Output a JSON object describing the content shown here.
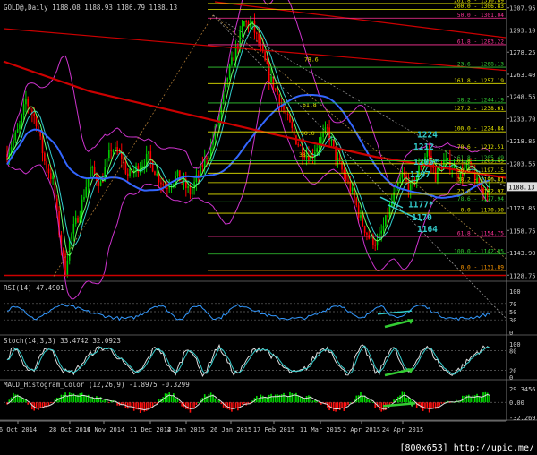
{
  "panels": {
    "price": {
      "label": "GOLD@,Daily  1188.08 1188.93 1186.79 1188.13",
      "ylim": [
        1125.3,
        1312.0
      ],
      "ticks": [
        "1307.95",
        "1293.10",
        "1278.25",
        "1263.40",
        "1248.55",
        "1233.70",
        "1218.85",
        "1203.55",
        "1188.70",
        "1173.85",
        "1158.75",
        "1143.90",
        "1128.75"
      ],
      "current": "1188.13",
      "fib_levels": [
        {
          "label": "261.8 - 1310.89",
          "value": 1310.89,
          "color": "#e6e600"
        },
        {
          "label": "200.0 - 1306.83",
          "value": 1306.83,
          "color": "#e6e600"
        },
        {
          "label": "50.0 - 1301.04",
          "value": 1301.04,
          "color": "#ff3399"
        },
        {
          "label": "61.8 - 1283.22",
          "value": 1283.22,
          "color": "#ff3399"
        },
        {
          "label": "23.6 - 1268.13",
          "value": 1268.13,
          "color": "#33cc33"
        },
        {
          "label": "161.8 - 1257.19",
          "value": 1257.19,
          "color": "#e6e600"
        },
        {
          "label": "38.2 - 1244.19",
          "value": 1244.19,
          "color": "#33cc33"
        },
        {
          "label": "127.2 - 1238.61",
          "value": 1238.61,
          "color": "#e6e600"
        },
        {
          "label": "100.0 - 1224.84",
          "value": 1224.84,
          "color": "#e6e600"
        },
        {
          "label": "78.6 - 1212.51",
          "value": 1212.51,
          "color": "#e6e600"
        },
        {
          "label": "61.8 - 1205.49",
          "value": 1205.49,
          "color": "#33cc33"
        },
        {
          "label": "61.8 - 1203.45",
          "value": 1203.45,
          "color": "#e6e600"
        },
        {
          "label": "50.0 - 1197.15",
          "value": 1197.15,
          "color": "#e6e600"
        },
        {
          "label": "38.2 - 1190.81",
          "value": 1190.81,
          "color": "#e6e600"
        },
        {
          "label": "23.6 - 1182.97",
          "value": 1182.97,
          "color": "#e6e600"
        },
        {
          "label": "78.6 - 1177.94",
          "value": 1177.94,
          "color": "#33cc33"
        },
        {
          "label": "0.0 - 1170.30",
          "value": 1170.3,
          "color": "#e6e600"
        },
        {
          "label": "61.8 - 1154.75",
          "value": 1154.75,
          "color": "#ff3399"
        },
        {
          "label": "100.0 - 1142.85",
          "value": 1142.85,
          "color": "#33cc33"
        },
        {
          "label": "0.0 - 1131.89",
          "value": 1131.89,
          "color": "#ff9900"
        }
      ],
      "annotations": [
        {
          "text": "1224",
          "value": 1223.5,
          "color": "#33cccc"
        },
        {
          "text": "1212",
          "value": 1215.2,
          "color": "#33cccc"
        },
        {
          "text": "1205*",
          "value": 1205.0,
          "color": "#33cccc"
        },
        {
          "text": "1197",
          "value": 1196.8,
          "color": "#33cccc"
        },
        {
          "text": "1177*",
          "value": 1176.5,
          "color": "#33cccc"
        },
        {
          "text": "1170",
          "value": 1168.0,
          "color": "#33cccc"
        },
        {
          "text": "1164",
          "value": 1160.2,
          "color": "#33cccc"
        }
      ],
      "fan_labels": [
        {
          "text": "78.6",
          "value": 1274.0
        },
        {
          "text": "61.8",
          "value": 1243.5
        },
        {
          "text": "50.0",
          "value": 1224.5
        },
        {
          "text": "38.2",
          "value": 1210.0
        }
      ]
    },
    "rsi": {
      "label": "RSI(14) 47.4901",
      "ticks": [
        "100",
        "70",
        "50",
        "30",
        "0"
      ]
    },
    "stoch": {
      "label": "Stoch(14,3,3) 33.4742 32.0923",
      "ticks": [
        "100",
        "80",
        "20",
        "0"
      ]
    },
    "macd": {
      "label": "MACD_Histogram_Color (12,26,9) -1.8975 -0.3299",
      "ticks": [
        "29.3456",
        "0.00",
        "-32.2697"
      ]
    }
  },
  "x_labels": [
    "6 Oct 2014",
    "28 Oct 2014",
    "19 Nov 2014",
    "11 Dec 2014",
    "2 Jan 2015",
    "26 Jan 2015",
    "17 Feb 2015",
    "11 Mar 2015",
    "2 Apr 2015",
    "24 Apr 2015"
  ],
  "watermark": "[800x653] http://upic.me/",
  "colors": {
    "background": "#000000",
    "up_candle": "#00cc00",
    "down_candle": "#ff0000",
    "ma_blue": "#3366ff",
    "ma_red": "#cc0000",
    "bollinger": "#cc33cc",
    "grid": "#333333",
    "arrow": "#33cc33",
    "rsi_line": "#3399ff",
    "macd_up": "#00dd00",
    "macd_down": "#ff1111"
  }
}
